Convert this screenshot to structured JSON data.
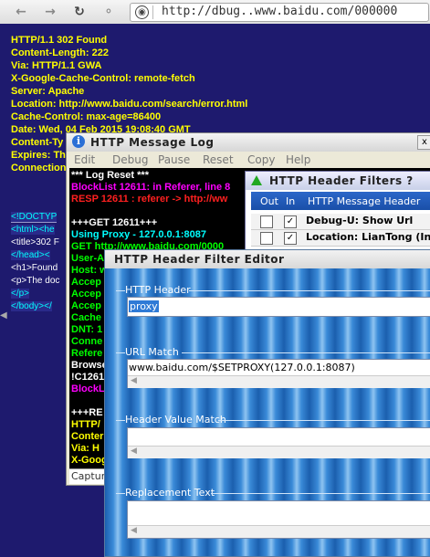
{
  "browser": {
    "url": "http://dbug..www.baidu.com/000000",
    "nav_icons": [
      "back-arrow",
      "forward-arrow",
      "reload",
      "key",
      "globe"
    ]
  },
  "page_headers": [
    "HTTP/1.1 302 Found",
    "Content-Length: 222",
    "Via: HTTP/1.1 GWA",
    "X-Google-Cache-Control: remote-fetch",
    "Server: Apache",
    "Location: http://www.baidu.com/search/error.html",
    "Cache-Control: max-age=86400",
    "Date: Wed, 04 Feb 2015 19:08:40 GMT",
    "Content-Ty",
    "Expires: Th",
    "Connection"
  ],
  "page_source": [
    "<!DOCTYP",
    "<html><he",
    "<title>302 F",
    "</head><",
    "<h1>Found",
    "<p>The doc",
    "</p>",
    "</body></"
  ],
  "log_window": {
    "title": "HTTP Message Log",
    "close": "x",
    "menu": [
      "Edit",
      "Debug",
      "Pause",
      "Reset",
      "Copy",
      "Help"
    ],
    "lines": [
      {
        "text": "*** Log Reset ***",
        "color": "#ffffff"
      },
      {
        "text": "BlockList 12611: in Referer, line 8",
        "color": "#ff00ff"
      },
      {
        "text": "RESP 12611 : referer -> http://ww",
        "color": "#ff2020"
      },
      {
        "text": "",
        "color": "#ffffff"
      },
      {
        "text": "+++GET 12611+++",
        "color": "#ffffff"
      },
      {
        "text": "Using Proxy - 127.0.0.1:8087",
        "color": "#00ffff"
      },
      {
        "text": "GET http://www.baidu.com/0000",
        "color": "#00ff00"
      },
      {
        "text": "User-A",
        "color": "#00ff00"
      },
      {
        "text": "Host: w",
        "color": "#00ff00"
      },
      {
        "text": "Accep",
        "color": "#00ff00"
      },
      {
        "text": "Accep",
        "color": "#00ff00"
      },
      {
        "text": "Accep",
        "color": "#00ff00"
      },
      {
        "text": "Cache",
        "color": "#00ff00"
      },
      {
        "text": "DNT: 1",
        "color": "#00ff00"
      },
      {
        "text": "Conne",
        "color": "#00ff00"
      },
      {
        "text": "Refere",
        "color": "#00ff00"
      },
      {
        "text": "Browse",
        "color": "#ffffff"
      },
      {
        "text": "!C1261",
        "color": "#ffffff"
      },
      {
        "text": "BlockL",
        "color": "#ff00ff"
      },
      {
        "text": "",
        "color": "#ffffff"
      },
      {
        "text": "+++RE",
        "color": "#ffffff"
      },
      {
        "text": "HTTP/",
        "color": "#ffff00"
      },
      {
        "text": "Conter",
        "color": "#ffff00"
      },
      {
        "text": "Via: H",
        "color": "#ffff00"
      },
      {
        "text": "X-Goog",
        "color": "#ffff00"
      }
    ],
    "status": "Captur"
  },
  "filters_window": {
    "title": "HTTP Header Filters ?",
    "columns": [
      "Out",
      "In",
      "HTTP Message Header"
    ],
    "rows": [
      {
        "out_checked": false,
        "in_checked": true,
        "name": "Debug-U: Show Url"
      },
      {
        "out_checked": false,
        "in_checked": true,
        "name": "Location: LianTong (In)"
      }
    ]
  },
  "editor_window": {
    "title": "HTTP Header Filter Editor",
    "http_header_label": "HTTP Header",
    "http_header_value": "proxy",
    "url_match_label": "URL Match",
    "url_match_value": "www.baidu.com/$SETPROXY(127.0.0.1:8087)",
    "header_value_match_label": "Header Value Match",
    "header_value_match_value": "",
    "replacement_text_label": "Replacement Text",
    "replacement_text_value": ""
  }
}
